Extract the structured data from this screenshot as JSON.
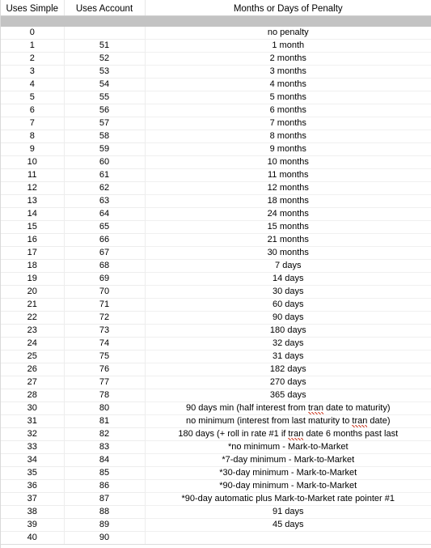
{
  "table": {
    "columns": [
      {
        "key": "uses_simple",
        "label": "Uses Simple"
      },
      {
        "key": "uses_account",
        "label": "Uses Account"
      },
      {
        "key": "penalty",
        "label": "Months or Days of Penalty"
      }
    ],
    "band_color": "#c3c3c3",
    "gridline_color": "#ededed",
    "spellcheck_color": "#d1402a",
    "spellcheck_word": "tran",
    "rows": [
      {
        "uses_simple": "0",
        "uses_account": "",
        "penalty": "no penalty"
      },
      {
        "uses_simple": "1",
        "uses_account": "51",
        "penalty": "1 month"
      },
      {
        "uses_simple": "2",
        "uses_account": "52",
        "penalty": "2 months"
      },
      {
        "uses_simple": "3",
        "uses_account": "53",
        "penalty": "3 months"
      },
      {
        "uses_simple": "4",
        "uses_account": "54",
        "penalty": "4 months"
      },
      {
        "uses_simple": "5",
        "uses_account": "55",
        "penalty": "5 months"
      },
      {
        "uses_simple": "6",
        "uses_account": "56",
        "penalty": "6 months"
      },
      {
        "uses_simple": "7",
        "uses_account": "57",
        "penalty": "7 months"
      },
      {
        "uses_simple": "8",
        "uses_account": "58",
        "penalty": "8 months"
      },
      {
        "uses_simple": "9",
        "uses_account": "59",
        "penalty": "9 months"
      },
      {
        "uses_simple": "10",
        "uses_account": "60",
        "penalty": "10 months"
      },
      {
        "uses_simple": "11",
        "uses_account": "61",
        "penalty": "11 months"
      },
      {
        "uses_simple": "12",
        "uses_account": "62",
        "penalty": "12 months"
      },
      {
        "uses_simple": "13",
        "uses_account": "63",
        "penalty": "18 months"
      },
      {
        "uses_simple": "14",
        "uses_account": "64",
        "penalty": "24 months"
      },
      {
        "uses_simple": "15",
        "uses_account": "65",
        "penalty": "15 months"
      },
      {
        "uses_simple": "16",
        "uses_account": "66",
        "penalty": "21 months"
      },
      {
        "uses_simple": "17",
        "uses_account": "67",
        "penalty": "30 months"
      },
      {
        "uses_simple": "18",
        "uses_account": "68",
        "penalty": "7 days"
      },
      {
        "uses_simple": "19",
        "uses_account": "69",
        "penalty": "14 days"
      },
      {
        "uses_simple": "20",
        "uses_account": "70",
        "penalty": "30 days"
      },
      {
        "uses_simple": "21",
        "uses_account": "71",
        "penalty": "60 days"
      },
      {
        "uses_simple": "22",
        "uses_account": "72",
        "penalty": "90 days"
      },
      {
        "uses_simple": "23",
        "uses_account": "73",
        "penalty": "180 days"
      },
      {
        "uses_simple": "24",
        "uses_account": "74",
        "penalty": "32 days"
      },
      {
        "uses_simple": "25",
        "uses_account": "75",
        "penalty": "31 days"
      },
      {
        "uses_simple": "26",
        "uses_account": "76",
        "penalty": "182 days"
      },
      {
        "uses_simple": "27",
        "uses_account": "77",
        "penalty": "270 days"
      },
      {
        "uses_simple": "28",
        "uses_account": "78",
        "penalty": "365 days"
      },
      {
        "uses_simple": "30",
        "uses_account": "80",
        "penalty": "90 days min (half interest from tran date to maturity)",
        "misspelled": "tran"
      },
      {
        "uses_simple": "31",
        "uses_account": "81",
        "penalty": "no minimum (interest from last maturity to tran date)",
        "misspelled": "tran"
      },
      {
        "uses_simple": "32",
        "uses_account": "82",
        "penalty": "180 days (+ roll in rate #1 if tran date 6 months past last",
        "misspelled": "tran",
        "truncated": true
      },
      {
        "uses_simple": "33",
        "uses_account": "83",
        "penalty": "*no minimum - Mark-to-Market"
      },
      {
        "uses_simple": "34",
        "uses_account": "84",
        "penalty": "*7-day minimum - Mark-to-Market"
      },
      {
        "uses_simple": "35",
        "uses_account": "85",
        "penalty": "*30-day minimum - Mark-to-Market"
      },
      {
        "uses_simple": "36",
        "uses_account": "86",
        "penalty": "*90-day minimum - Mark-to-Market"
      },
      {
        "uses_simple": "37",
        "uses_account": "87",
        "penalty": "*90-day automatic plus Mark-to-Market rate pointer #1"
      },
      {
        "uses_simple": "38",
        "uses_account": "88",
        "penalty": "91 days"
      },
      {
        "uses_simple": "39",
        "uses_account": "89",
        "penalty": "45 days"
      },
      {
        "uses_simple": "40",
        "uses_account": "90",
        "penalty": ""
      }
    ]
  }
}
